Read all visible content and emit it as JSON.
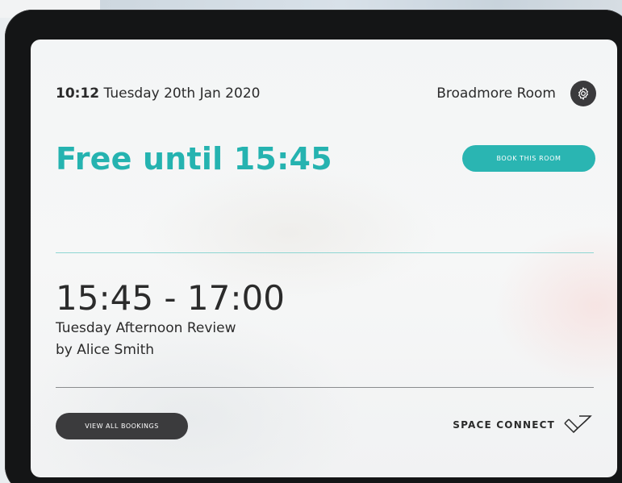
{
  "header": {
    "time": "10:12",
    "date": "Tuesday 20th Jan 2020",
    "room_name": "Broadmore Room"
  },
  "status": {
    "headline": "Free until 15:45",
    "book_button_label": "BOOK THIS ROOM"
  },
  "next_booking": {
    "time_range": "15:45 - 17:00",
    "title": "Tuesday Afternoon Review",
    "owner": "by Alice Smith"
  },
  "footer": {
    "view_all_label": "VIEW ALL BOOKINGS",
    "brand_name": "SPACE CONNECT"
  },
  "icons": {
    "settings": "gear-icon",
    "brand_logo": "space-connect-logo-icon"
  },
  "colors": {
    "accent": "#2ab5b2",
    "dark_button": "#3b3b3d",
    "text": "#2b2b2b"
  }
}
